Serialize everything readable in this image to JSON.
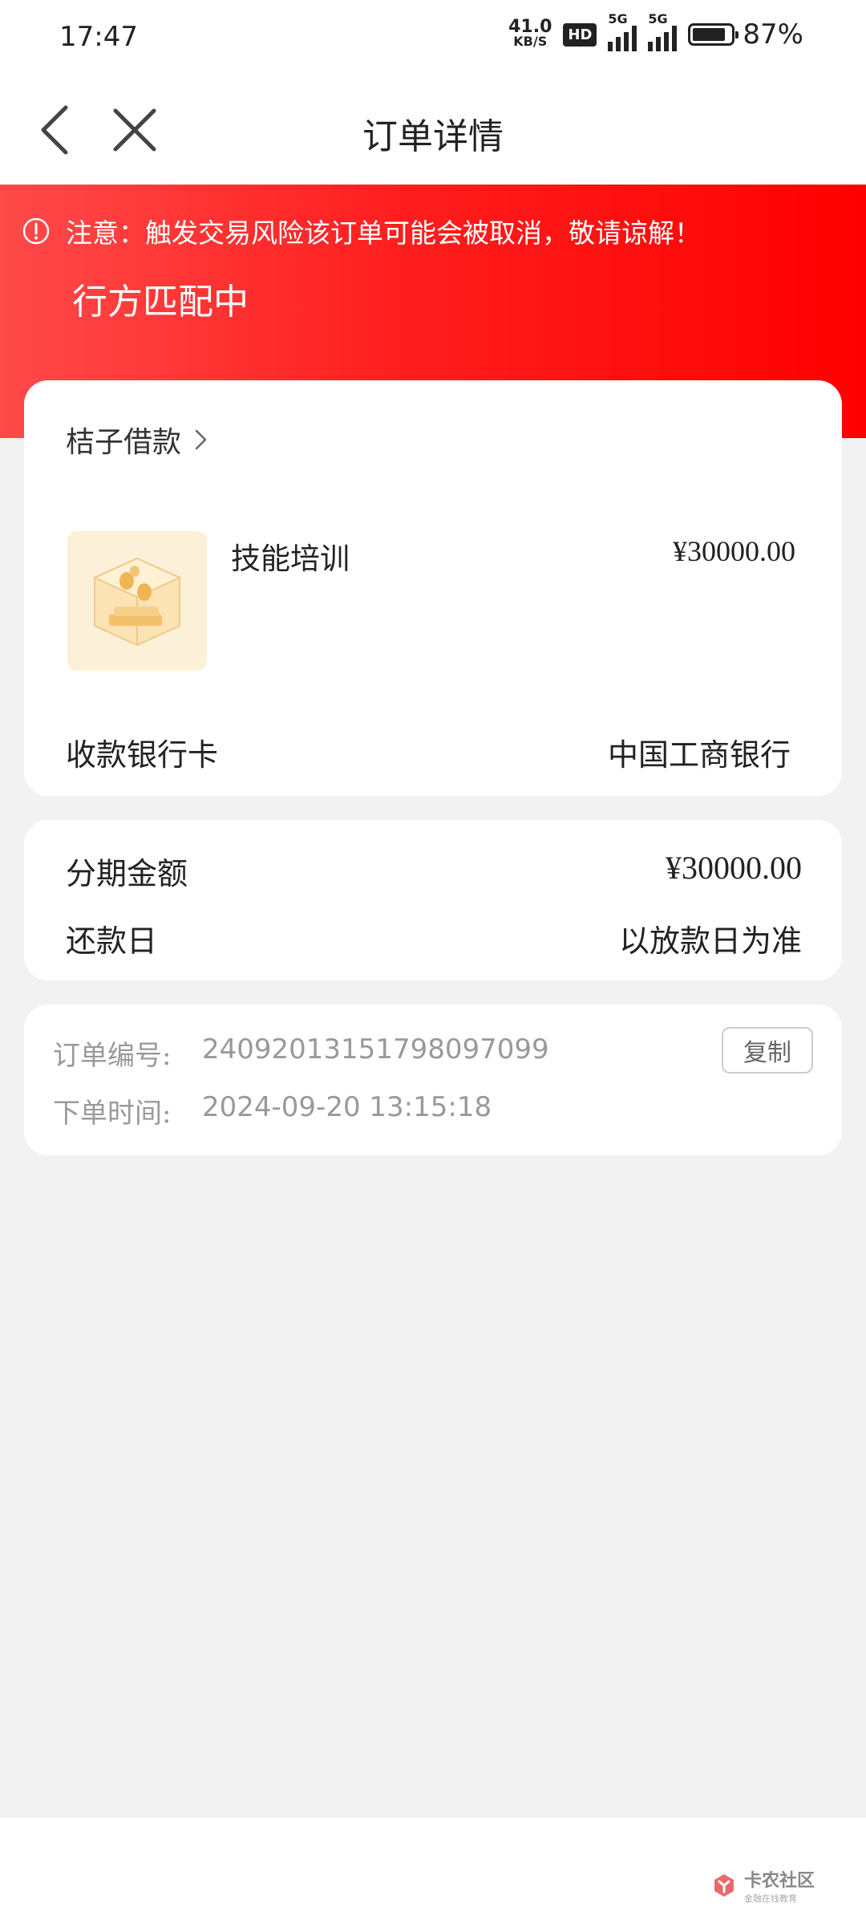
{
  "status_bar": {
    "time": "17:47",
    "net_speed_value": "41.0",
    "net_speed_unit": "KB/S",
    "hd_badge": "HD",
    "sim1_label": "5G",
    "sim2_label": "5G",
    "battery_level": 0.87,
    "battery_text": "87%"
  },
  "nav": {
    "title": "订单详情",
    "back_icon": "chevron-left-icon",
    "close_icon": "close-icon"
  },
  "banner": {
    "warning_text": "注意：触发交易风险该订单可能会被取消，敬请谅解！",
    "status_text": "行方匹配中",
    "warning_icon": "exclamation-circle-icon",
    "gradient_start": "#ff4a4a",
    "gradient_end": "#ff0000"
  },
  "order_card": {
    "merchant_name": "桔子借款",
    "product_name": "技能培训",
    "product_price": "¥30000.00",
    "bank_label": "收款银行卡",
    "bank_value": "中国工商银行"
  },
  "installment_card": {
    "amount_label": "分期金额",
    "amount_value": "¥30000.00",
    "repay_label": "还款日",
    "repay_value": "以放款日为准"
  },
  "meta_card": {
    "order_no_label": "订单编号:",
    "order_no_value": "24092013151798097099",
    "order_time_label": "下单时间:",
    "order_time_value": "2024-09-20 13:15:18",
    "copy_label": "复制"
  },
  "watermark": {
    "main": "卡农社区",
    "sub": "金融在线教育"
  }
}
